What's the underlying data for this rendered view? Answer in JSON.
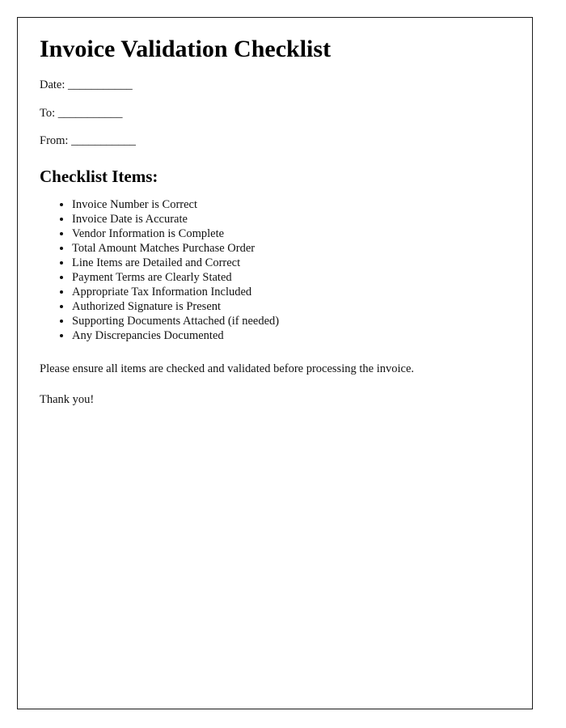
{
  "document": {
    "title": "Invoice Validation Checklist",
    "fields": [
      {
        "label": "Date:",
        "blank": "___________"
      },
      {
        "label": "To:",
        "blank": "___________"
      },
      {
        "label": "From:",
        "blank": "___________"
      }
    ],
    "section_heading": "Checklist Items:",
    "checklist_items": [
      "Invoice Number is Correct",
      "Invoice Date is Accurate",
      "Vendor Information is Complete",
      "Total Amount Matches Purchase Order",
      "Line Items are Detailed and Correct",
      "Payment Terms are Clearly Stated",
      "Appropriate Tax Information Included",
      "Authorized Signature is Present",
      "Supporting Documents Attached (if needed)",
      "Any Discrepancies Documented"
    ],
    "closing_note": "Please ensure all items are checked and validated before processing the invoice.",
    "thanks": "Thank you!"
  }
}
